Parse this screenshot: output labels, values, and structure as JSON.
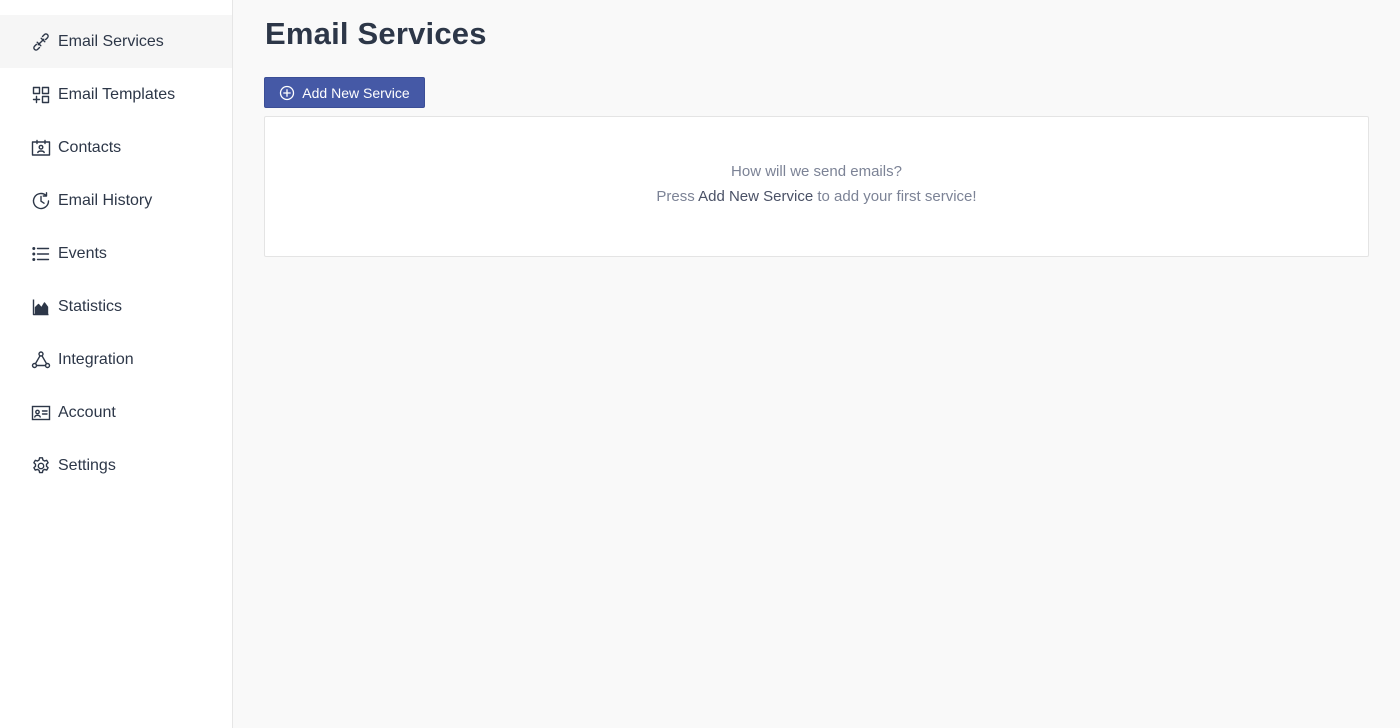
{
  "sidebar": {
    "items": [
      {
        "label": "Email Services",
        "icon": "link-icon",
        "active": true
      },
      {
        "label": "Email Templates",
        "icon": "templates-icon"
      },
      {
        "label": "Contacts",
        "icon": "contacts-icon"
      },
      {
        "label": "Email History",
        "icon": "history-icon"
      },
      {
        "label": "Events",
        "icon": "list-icon"
      },
      {
        "label": "Statistics",
        "icon": "area-chart-icon"
      },
      {
        "label": "Integration",
        "icon": "integration-icon"
      },
      {
        "label": "Account",
        "icon": "id-card-icon"
      },
      {
        "label": "Settings",
        "icon": "gear-icon"
      }
    ]
  },
  "main": {
    "title": "Email Services",
    "add_button_label": "Add New Service",
    "empty_state": {
      "line1": "How will we send emails?",
      "line2_prefix": "Press ",
      "line2_emphasis": "Add New Service",
      "line2_suffix": " to add your first service!"
    }
  },
  "colors": {
    "accent": "#4559a6",
    "background": "#f9f9f9",
    "text": "#2d3748",
    "muted_text": "#7c8396"
  }
}
